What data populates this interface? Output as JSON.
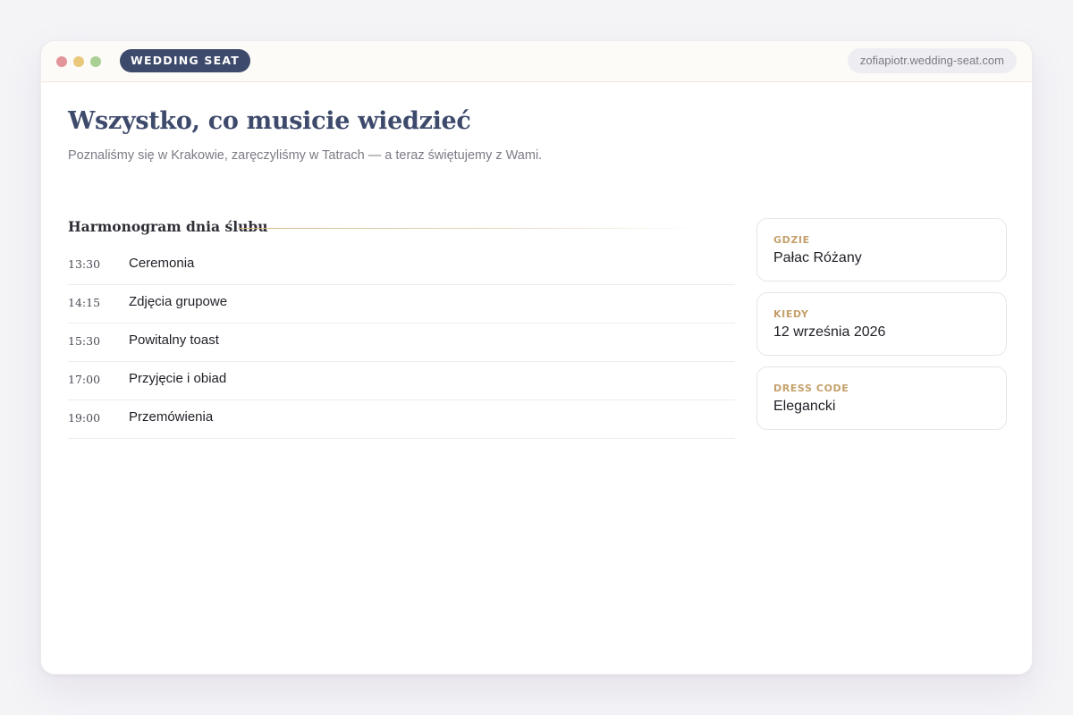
{
  "colors": {
    "brand": "#3e4a6b",
    "accent_gold": "#c4a06a",
    "dot_red": "#e3959b",
    "dot_yellow": "#e9c77b",
    "dot_green": "#a9cf95"
  },
  "window": {
    "brand": "WEDDING SEAT",
    "url": "zofiapiotr.wedding-seat.com",
    "dots": [
      "close-dot",
      "minimize-dot",
      "maximize-dot"
    ]
  },
  "page": {
    "title": "Wszystko, co musicie wiedzieć",
    "subtitle": "Poznaliśmy się w Krakowie, zaręczyliśmy w Tatrach — a teraz świętujemy z Wami."
  },
  "schedule": {
    "title": "Harmonogram dnia ślubu",
    "items": [
      {
        "time": "13:30",
        "label": "Ceremonia"
      },
      {
        "time": "14:15",
        "label": "Zdjęcia grupowe"
      },
      {
        "time": "15:30",
        "label": "Powitalny toast"
      },
      {
        "time": "17:00",
        "label": "Przyjęcie i obiad"
      },
      {
        "time": "19:00",
        "label": "Przemówienia"
      }
    ]
  },
  "details": [
    {
      "label": "GDZIE",
      "value": "Pałac Różany"
    },
    {
      "label": "KIEDY",
      "value": "12 września 2026"
    },
    {
      "label": "DRESS CODE",
      "value": "Elegancki"
    }
  ]
}
